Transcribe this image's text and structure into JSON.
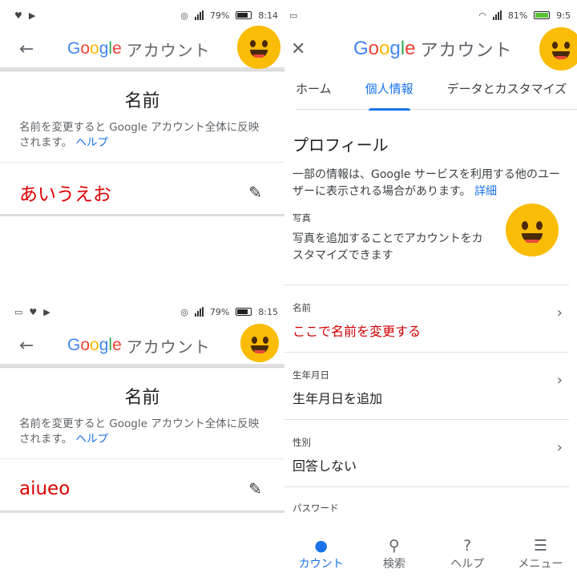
{
  "left_top": {
    "status": {
      "battery": "79%",
      "time": "8:14"
    },
    "logo": "Google",
    "title": "アカウント",
    "card_title": "名前",
    "description": "名前を変更すると Google アカウント全体に反映されます。",
    "help_link": "ヘルプ",
    "name_value": "あいうえお"
  },
  "left_bottom": {
    "status": {
      "battery": "79%",
      "time": "8:15"
    },
    "logo": "Google",
    "title": "アカウント",
    "card_title": "名前",
    "description": "名前を変更すると Google アカウント全体に反映されます。",
    "help_link": "ヘルプ",
    "name_value": "aiueo"
  },
  "right": {
    "status": {
      "battery": "81%",
      "time": "9:5"
    },
    "logo": "Google",
    "title": "アカウント",
    "tabs": [
      "ホーム",
      "個人情報",
      "データとカスタマイズ"
    ],
    "profile_heading": "プロフィール",
    "profile_desc": "一部の情報は、Google サービスを利用する他のユーザーに表示される場合があります。",
    "detail_link": "詳細",
    "photo": {
      "label": "写真",
      "desc": "写真を追加することでアカウントをカスタマイズできます"
    },
    "rows": [
      {
        "label": "名前",
        "value": "ここで名前を変更する"
      },
      {
        "label": "生年月日",
        "value": "生年月日を追加"
      },
      {
        "label": "性別",
        "value": "回答しない"
      },
      {
        "label": "パスワード",
        "value": ""
      }
    ],
    "bottom_nav": [
      "カウント",
      "検索",
      "ヘルプ",
      "メニュー"
    ]
  },
  "colors": {
    "accent": "#1a73e8",
    "name_red": "#e00000"
  },
  "icons": [
    "heart-icon",
    "back-arrow-icon",
    "pencil-icon",
    "chevron-right-icon",
    "account-icon",
    "search-icon",
    "help-icon",
    "menu-icon"
  ]
}
